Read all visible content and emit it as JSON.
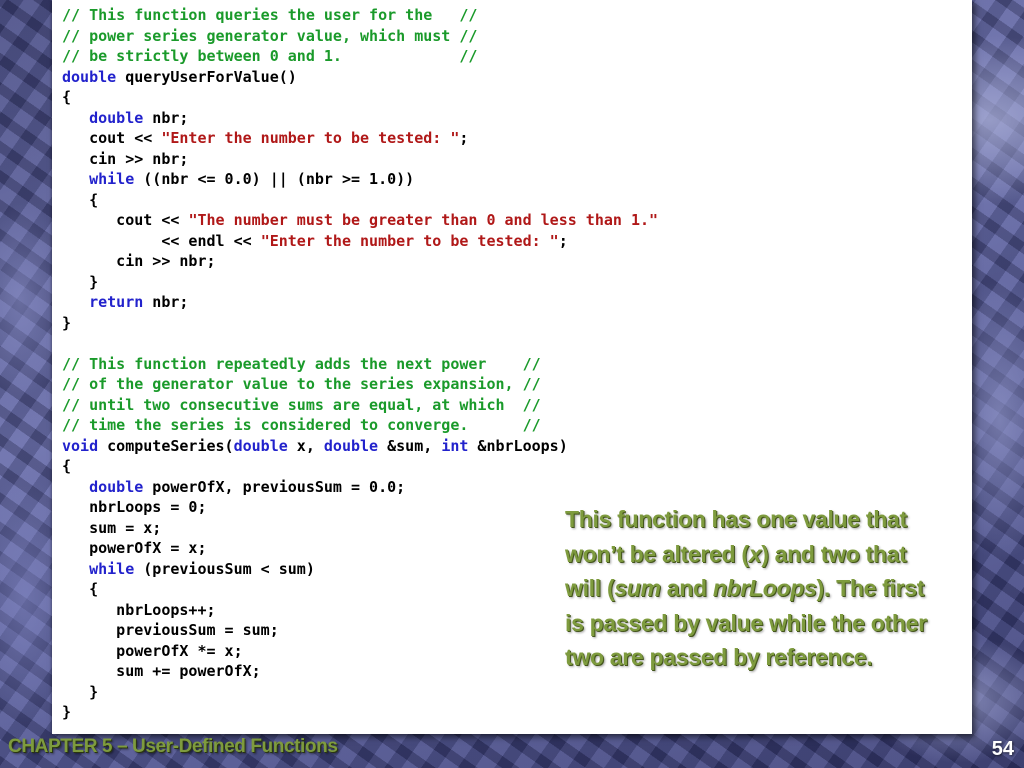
{
  "code_lines": [
    [
      [
        "comment",
        "// This function queries the user for the   //"
      ]
    ],
    [
      [
        "comment",
        "// power series generator value, which must //"
      ]
    ],
    [
      [
        "comment",
        "// be strictly between 0 and 1.             //"
      ]
    ],
    [
      [
        "keyword",
        "double"
      ],
      [
        "plain",
        " queryUserForValue()"
      ]
    ],
    [
      [
        "plain",
        "{"
      ]
    ],
    [
      [
        "plain",
        "   "
      ],
      [
        "keyword",
        "double"
      ],
      [
        "plain",
        " nbr;"
      ]
    ],
    [
      [
        "plain",
        "   cout << "
      ],
      [
        "string",
        "\"Enter the number to be tested: \""
      ],
      [
        "plain",
        ";"
      ]
    ],
    [
      [
        "plain",
        "   cin >> nbr;"
      ]
    ],
    [
      [
        "plain",
        "   "
      ],
      [
        "keyword",
        "while"
      ],
      [
        "plain",
        " ((nbr <= 0.0) || (nbr >= 1.0))"
      ]
    ],
    [
      [
        "plain",
        "   {"
      ]
    ],
    [
      [
        "plain",
        "      cout << "
      ],
      [
        "string",
        "\"The number must be greater than 0 and less than 1.\""
      ]
    ],
    [
      [
        "plain",
        "           << endl << "
      ],
      [
        "string",
        "\"Enter the number to be tested: \""
      ],
      [
        "plain",
        ";"
      ]
    ],
    [
      [
        "plain",
        "      cin >> nbr;"
      ]
    ],
    [
      [
        "plain",
        "   }"
      ]
    ],
    [
      [
        "plain",
        "   "
      ],
      [
        "keyword",
        "return"
      ],
      [
        "plain",
        " nbr;"
      ]
    ],
    [
      [
        "plain",
        "}"
      ]
    ],
    [
      [
        "plain",
        ""
      ]
    ],
    [
      [
        "comment",
        "// This function repeatedly adds the next power    //"
      ]
    ],
    [
      [
        "comment",
        "// of the generator value to the series expansion, //"
      ]
    ],
    [
      [
        "comment",
        "// until two consecutive sums are equal, at which  //"
      ]
    ],
    [
      [
        "comment",
        "// time the series is considered to converge.      //"
      ]
    ],
    [
      [
        "keyword",
        "void"
      ],
      [
        "plain",
        " computeSeries("
      ],
      [
        "keyword",
        "double"
      ],
      [
        "plain",
        " x, "
      ],
      [
        "keyword",
        "double"
      ],
      [
        "plain",
        " &sum, "
      ],
      [
        "keyword",
        "int"
      ],
      [
        "plain",
        " &nbrLoops)"
      ]
    ],
    [
      [
        "plain",
        "{"
      ]
    ],
    [
      [
        "plain",
        "   "
      ],
      [
        "keyword",
        "double"
      ],
      [
        "plain",
        " powerOfX, previousSum = 0.0;"
      ]
    ],
    [
      [
        "plain",
        "   nbrLoops = 0;"
      ]
    ],
    [
      [
        "plain",
        "   sum = x;"
      ]
    ],
    [
      [
        "plain",
        "   powerOfX = x;"
      ]
    ],
    [
      [
        "plain",
        "   "
      ],
      [
        "keyword",
        "while"
      ],
      [
        "plain",
        " (previousSum < sum)"
      ]
    ],
    [
      [
        "plain",
        "   {"
      ]
    ],
    [
      [
        "plain",
        "      nbrLoops++;"
      ]
    ],
    [
      [
        "plain",
        "      previousSum = sum;"
      ]
    ],
    [
      [
        "plain",
        "      powerOfX *= x;"
      ]
    ],
    [
      [
        "plain",
        "      sum += powerOfX;"
      ]
    ],
    [
      [
        "plain",
        "   }"
      ]
    ],
    [
      [
        "plain",
        "}"
      ]
    ]
  ],
  "callout": {
    "line1": "This function has one value that",
    "line2_a": "won’t be altered (",
    "line2_x": "x",
    "line2_b": ") and two that",
    "line3_a": "will  (",
    "line3_sum": "sum",
    "line3_and": " and ",
    "line3_nbr": "nbrLoops",
    "line3_b": "). The first",
    "line4": "is passed by value while the other",
    "line5": "two are passed by  reference."
  },
  "footer": {
    "chapter": "CHAPTER 5 – User-Defined Functions",
    "page_number": "54"
  },
  "colors": {
    "comment": "#1a9a2a",
    "keyword": "#2222cc",
    "string": "#b01818",
    "callout_text": "#7e9b3e",
    "background": "#5a5f8c"
  }
}
